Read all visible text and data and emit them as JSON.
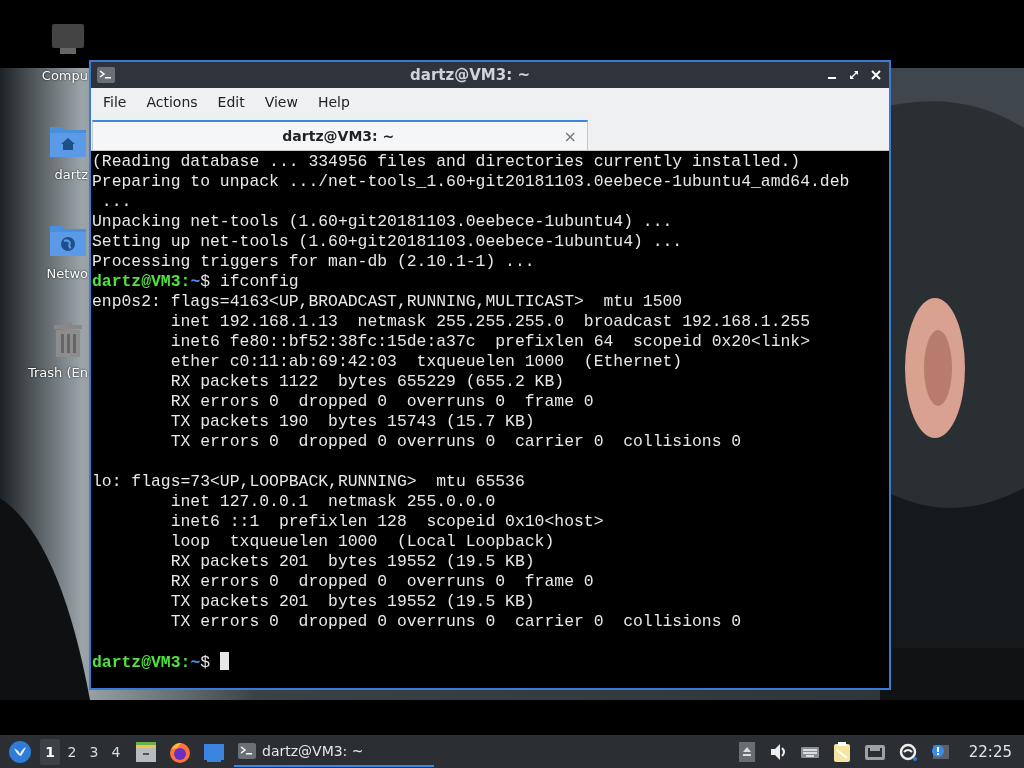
{
  "desktop_icons": [
    {
      "kind": "computer",
      "label": "Compu"
    },
    {
      "kind": "home",
      "label": "dartz"
    },
    {
      "kind": "network",
      "label": "Netwo"
    },
    {
      "kind": "trash",
      "label": "Trash (En"
    }
  ],
  "window": {
    "title": "dartz@VM3: ~",
    "buttons": [
      {
        "kind": "minimize"
      },
      {
        "kind": "maximize"
      },
      {
        "kind": "close"
      }
    ]
  },
  "menu": [
    "File",
    "Actions",
    "Edit",
    "View",
    "Help"
  ],
  "tabs": [
    {
      "label": "dartz@VM3: ~",
      "selected": true,
      "close": "×"
    }
  ],
  "terminal": {
    "lines": [
      {
        "kind": "text",
        "text": "(Reading database ... 334956 files and directories currently installed.)"
      },
      {
        "kind": "text",
        "text": "Preparing to unpack .../net-tools_1.60+git20181103.0eebece-1ubuntu4_amd64.deb"
      },
      {
        "kind": "text",
        "text": " ..."
      },
      {
        "kind": "text",
        "text": "Unpacking net-tools (1.60+git20181103.0eebece-1ubuntu4) ..."
      },
      {
        "kind": "text",
        "text": "Setting up net-tools (1.60+git20181103.0eebece-1ubuntu4) ..."
      },
      {
        "kind": "text",
        "text": "Processing triggers for man-db (2.10.1-1) ..."
      },
      {
        "kind": "prompt",
        "user": "dartz@VM3:",
        "path": "~",
        "sign": "$",
        "command": "ifconfig"
      },
      {
        "kind": "text",
        "text": "enp0s2: flags=4163<UP,BROADCAST,RUNNING,MULTICAST>  mtu 1500"
      },
      {
        "kind": "text",
        "text": "        inet 192.168.1.13  netmask 255.255.255.0  broadcast 192.168.1.255"
      },
      {
        "kind": "text",
        "text": "        inet6 fe80::bf52:38fc:15de:a37c  prefixlen 64  scopeid 0x20<link>"
      },
      {
        "kind": "text",
        "text": "        ether c0:11:ab:69:42:03  txqueuelen 1000  (Ethernet)"
      },
      {
        "kind": "text",
        "text": "        RX packets 1122  bytes 655229 (655.2 KB)"
      },
      {
        "kind": "text",
        "text": "        RX errors 0  dropped 0  overruns 0  frame 0"
      },
      {
        "kind": "text",
        "text": "        TX packets 190  bytes 15743 (15.7 KB)"
      },
      {
        "kind": "text",
        "text": "        TX errors 0  dropped 0 overruns 0  carrier 0  collisions 0"
      },
      {
        "kind": "blank"
      },
      {
        "kind": "text",
        "text": "lo: flags=73<UP,LOOPBACK,RUNNING>  mtu 65536"
      },
      {
        "kind": "text",
        "text": "        inet 127.0.0.1  netmask 255.0.0.0"
      },
      {
        "kind": "text",
        "text": "        inet6 ::1  prefixlen 128  scopeid 0x10<host>"
      },
      {
        "kind": "text",
        "text": "        loop  txqueuelen 1000  (Local Loopback)"
      },
      {
        "kind": "text",
        "text": "        RX packets 201  bytes 19552 (19.5 KB)"
      },
      {
        "kind": "text",
        "text": "        RX errors 0  dropped 0  overruns 0  frame 0"
      },
      {
        "kind": "text",
        "text": "        TX packets 201  bytes 19552 (19.5 KB)"
      },
      {
        "kind": "text",
        "text": "        TX errors 0  dropped 0 overruns 0  carrier 0  collisions 0"
      },
      {
        "kind": "blank"
      },
      {
        "kind": "prompt",
        "user": "dartz@VM3:",
        "path": "~",
        "sign": "$",
        "cursor": true
      }
    ]
  },
  "taskbar": {
    "launchers": [
      {
        "kind": "start"
      }
    ],
    "workspaces": [
      {
        "label": "1",
        "selected": true
      },
      {
        "label": "2",
        "selected": false
      },
      {
        "label": "3",
        "selected": false
      },
      {
        "label": "4",
        "selected": false
      }
    ],
    "quicklaunch": [
      {
        "kind": "files"
      },
      {
        "kind": "browser"
      },
      {
        "kind": "desktop"
      }
    ],
    "tasks": [
      {
        "label": "dartz@VM3: ~",
        "selected": true
      }
    ],
    "tray": [
      {
        "kind": "eject"
      },
      {
        "kind": "volume"
      },
      {
        "kind": "keyboard"
      },
      {
        "kind": "clipboard"
      },
      {
        "kind": "network"
      },
      {
        "kind": "update"
      },
      {
        "kind": "info"
      }
    ],
    "clock": "22:25"
  }
}
